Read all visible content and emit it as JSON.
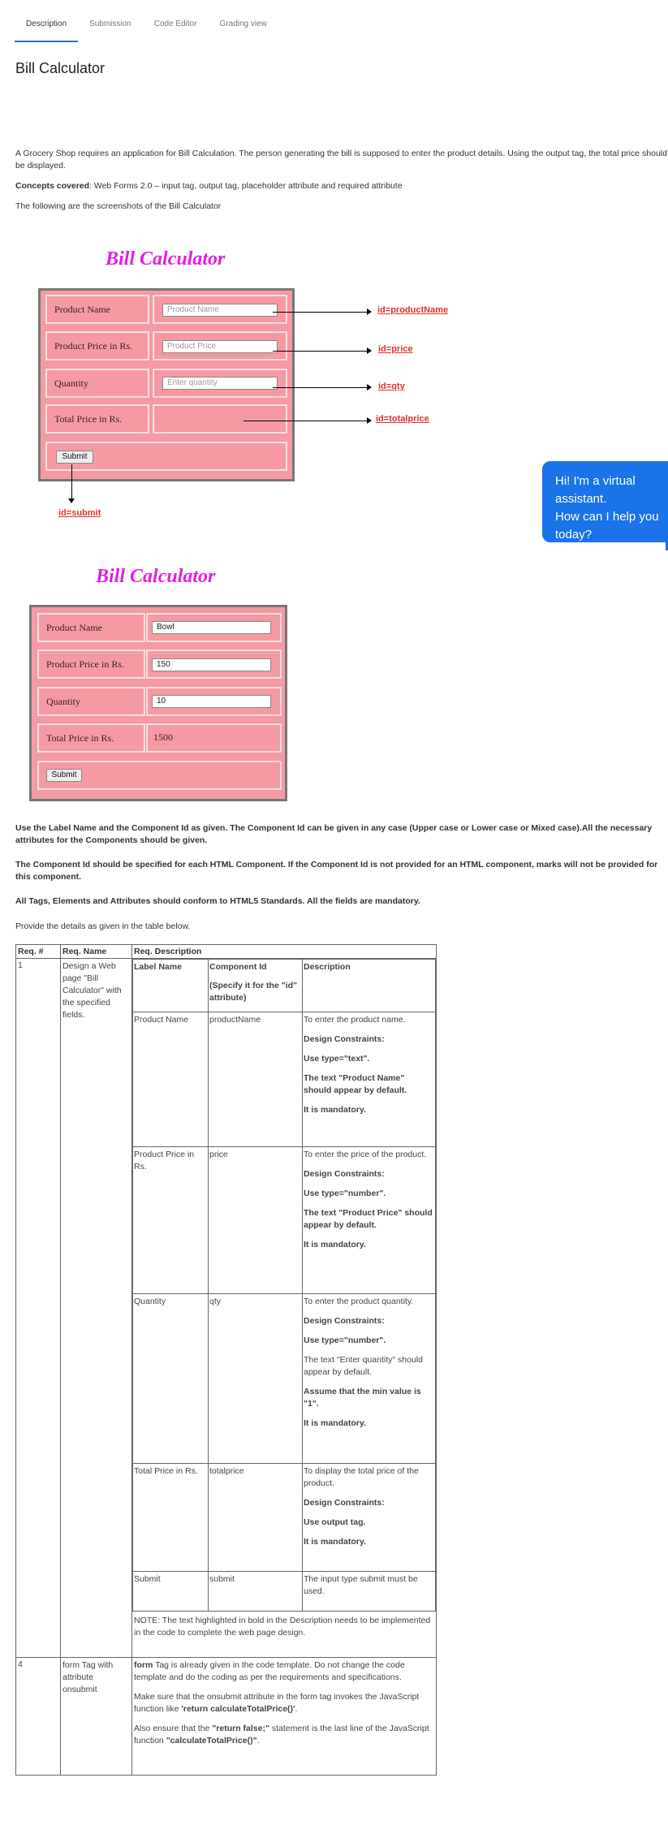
{
  "tabs": [
    {
      "label": "Description",
      "active": true
    },
    {
      "label": "Submission"
    },
    {
      "label": "Code Editor"
    },
    {
      "label": "Grading view"
    }
  ],
  "page_title": "Bill Calculator",
  "intro": {
    "p1": "A Grocery Shop requires an application for Bill Calculation. The person generating the bill is supposed to enter the product details. Using the output tag, the total price should be displayed.",
    "p2_bold": "Concepts covered",
    "p2_rest": ": Web Forms 2.0 – input tag, output tag, placeholder attribute and required attribute",
    "p3": "The following are the screenshots of the Bill Calculator"
  },
  "figure1": {
    "title": "Bill Calculator",
    "labels": [
      "Product Name",
      "Product Price in Rs.",
      "Quantity",
      "Total Price in Rs."
    ],
    "placeholders": [
      "Product Name",
      "Product Price",
      "Enter quantity"
    ],
    "submit": "Submit",
    "ids": [
      "id=productName",
      "id=price",
      "id=qty",
      "id=totalprice",
      "id=submit"
    ]
  },
  "figure2": {
    "title": "Bill Calculator",
    "labels": [
      "Product Name",
      "Product Price in Rs.",
      "Quantity",
      "Total Price in Rs."
    ],
    "values": [
      "Bowl",
      "150",
      "10"
    ],
    "total": "1500",
    "submit": "Submit"
  },
  "chat": {
    "line1": "Hi! I'm a virtual assistant.",
    "line2": "How can I help you",
    "line3": "today?"
  },
  "notes": {
    "n1": "Use the Label Name and the Component Id as given. The Component Id can be given in any case (Upper case or Lower case or Mixed case).All the necessary attributes for the Components should be given.",
    "n2": "The Component Id should be specified for each HTML Component. If the Component Id is not provided for an HTML component, marks will not be provided for this component.",
    "n3": "All Tags, Elements and Attributes should conform to HTML5 Standards. All the fields are mandatory.",
    "n4": "Provide the details as given in the table below."
  },
  "table": {
    "headers": [
      "Req. #",
      "Req. Name",
      "Req. Description"
    ],
    "row1": {
      "num": "1",
      "name": "Design a Web page \"Bill Calculator\" with the specified fields.",
      "inner_headers": [
        "Label Name",
        "Component  Id",
        "(Specify it for the \"id\" attribute)",
        "Description"
      ],
      "rows": [
        {
          "label": "Product Name",
          "id": "productName",
          "desc": [
            "To enter the product name.",
            "Design Constraints:",
            "Use type=\"text\".",
            " The text \"Product Name\" should appear by default.",
            " It is mandatory."
          ]
        },
        {
          "label": "Product Price in Rs.",
          "id": "price",
          "desc": [
            "To enter the price of the product.",
            "Design Constraints:",
            "Use type=\"number\".",
            "The text \"Product Price\" should appear by default.",
            "It is mandatory."
          ]
        },
        {
          "label": "Quantity",
          "id": "qty",
          "desc": [
            "To enter the product quantity.",
            "Design Constraints:",
            "Use type=\"number\".",
            " The text \"Enter quantity\" should appear by default.",
            "Assume that the min value is \"1\".",
            "It is mandatory."
          ]
        },
        {
          "label": "Total Price in Rs.",
          "id": "totalprice",
          "desc": [
            "To display the total price of the product.",
            "Design Constraints:",
            "Use output tag.",
            "It is mandatory."
          ]
        },
        {
          "label": "Submit",
          "id": "submit",
          "desc": [
            "The input type submit must be used."
          ]
        }
      ],
      "note": " NOTE: The text highlighted in bold in the Description needs to be implemented in the code to complete the web page design."
    },
    "row4": {
      "num": "4",
      "name": "form  Tag  with attribute onsubmit",
      "p1_bold": "form",
      "p1_rest": " Tag is already given in the code template. Do not change the code template and do the coding as per the requirements and specifications.",
      "p2_rest": "Make sure that the onsubmit attribute in the form tag invokes the JavaScript function like ",
      "p2_bold": "'return calculateTotalPrice()'",
      "p2_end": ".",
      "p3_rest": "Also ensure that the ",
      "p3_bold": "\"return false;\"",
      "p3_mid": " statement is the last line of the JavaScript function ",
      "p3_bold2": "\"calculateTotalPrice()\"",
      "p3_end": "."
    }
  }
}
